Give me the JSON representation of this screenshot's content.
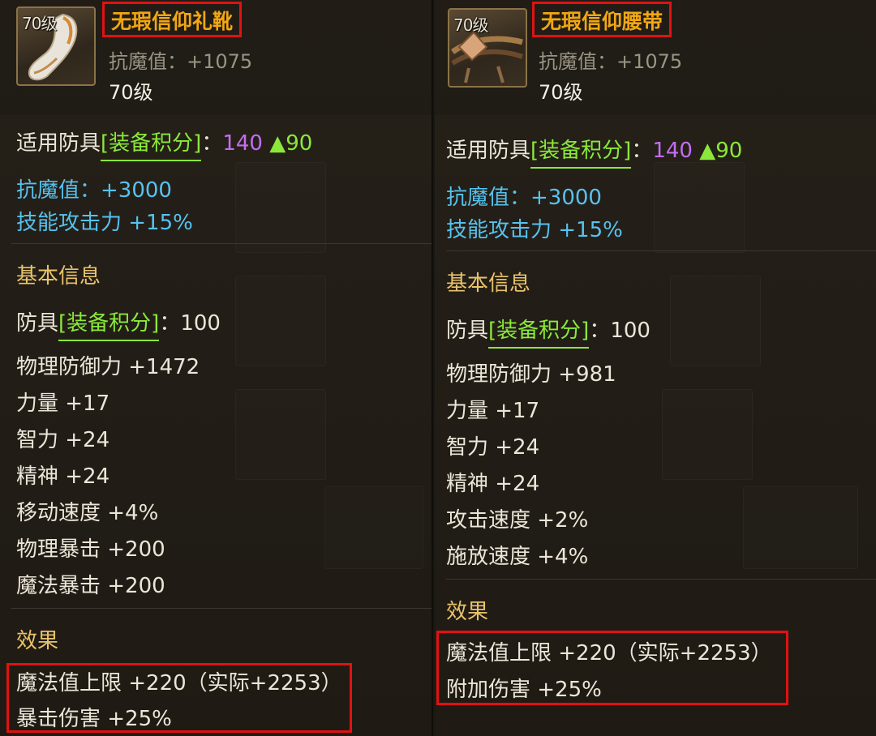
{
  "items": [
    {
      "icon_level": "70级",
      "name": "无瑕信仰礼靴",
      "icon": "boot-icon",
      "sub_stat": "抗魔值：+1075",
      "sub_level": "70级",
      "applicable": {
        "prefix": "适用防具",
        "tag": "[装备积分]",
        "colon": "：",
        "score": "140",
        "delta": "▲90"
      },
      "bonus_stats": [
        "抗魔值：+3000",
        "技能攻击力 +15%"
      ],
      "basic_title": "基本信息",
      "basic_score": {
        "prefix": "防具",
        "tag": "[装备积分]",
        "colon": "：",
        "value": "100"
      },
      "basic_stats": [
        "物理防御力 +1472",
        "力量 +17",
        "智力 +24",
        "精神 +24",
        "移动速度 +4%",
        "物理暴击 +200",
        "魔法暴击 +200"
      ],
      "effect_title": "效果",
      "effects": [
        "魔法值上限 +220（实际+2253）",
        "暴击伤害 +25%"
      ]
    },
    {
      "icon_level": "70级",
      "name": "无瑕信仰腰带",
      "icon": "belt-icon",
      "sub_stat": "抗魔值：+1075",
      "sub_level": "70级",
      "applicable": {
        "prefix": "适用防具",
        "tag": "[装备积分]",
        "colon": "：",
        "score": "140",
        "delta": "▲90"
      },
      "bonus_stats": [
        "抗魔值：+3000",
        "技能攻击力 +15%"
      ],
      "basic_title": "基本信息",
      "basic_score": {
        "prefix": "防具",
        "tag": "[装备积分]",
        "colon": "：",
        "value": "100"
      },
      "basic_stats": [
        "物理防御力 +981",
        "力量 +17",
        "智力 +24",
        "精神 +24",
        "攻击速度 +2%",
        "施放速度 +4%"
      ],
      "effect_title": "效果",
      "effects": [
        "魔法值上限 +220（实际+2253）",
        "附加伤害 +25%"
      ]
    }
  ],
  "colors": {
    "name": "#f2a713",
    "highlight_box": "#e01212",
    "blue_stat": "#57c2ee",
    "score": "#c46df0",
    "tag": "#8be83a"
  }
}
